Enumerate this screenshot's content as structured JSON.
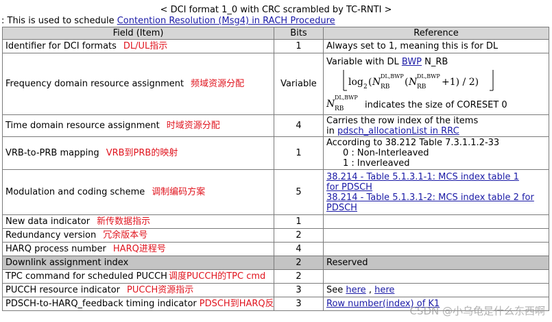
{
  "title": "< DCI format 1_0 with CRC scrambled by TC-RNTI >",
  "intro": {
    "prefix": ": This is used to schedule ",
    "link": "Contention Resolution (Msg4) in RACH Procedure"
  },
  "headers": {
    "field": "Field (Item)",
    "bits": "Bits",
    "reference": "Reference"
  },
  "rows": {
    "r0": {
      "field": "Identifier for DCI formats",
      "cn": "DL/UL指示",
      "bits": "1",
      "ref": "Always set to 1, meaning this is for DL"
    },
    "r1": {
      "field": "Frequency domain resource assignment",
      "cn": "频域资源分配",
      "bits": "Variable",
      "ref_prefix": "Variable with DL ",
      "ref_link": "BWP",
      "ref_suffix": " N_RB",
      "formula_log": "log",
      "formula_sub2": "2",
      "formula_N": "N",
      "formula_sup": "DL,BWP",
      "formula_sub": "RB",
      "formula_plus1": "+1) / 2)",
      "ref_size": "indicates the size of CORESET 0"
    },
    "r2": {
      "field": "Time domain resource assignment",
      "cn": "时域资源分配",
      "bits": "4",
      "ref_line1": "Carries the row index of the items",
      "ref_in": "in ",
      "ref_link": "pdsch_allocationList in RRC"
    },
    "r3": {
      "field": "VRB-to-PRB mapping",
      "cn": "VRB到PRB的映射",
      "bits": "1",
      "ref_line1": "According to 38.212 Table 7.3.1.1.2-33",
      "ref_line2": "0 : Non-Interleaved",
      "ref_line3": "1 : Inverleaved"
    },
    "r4": {
      "field": "Modulation and coding scheme",
      "cn": "调制编码方案",
      "bits": "5",
      "link1a": "38.214  - Table 5.1.3.1-1: MCS index table 1",
      "link1b": "for PDSCH",
      "link2a": "38.214 - Table 5.1.3.1-2: MCS index table 2 for",
      "link2b": "PDSCH"
    },
    "r5": {
      "field": "New data indicator",
      "cn": "新传数据指示",
      "bits": "1",
      "ref": ""
    },
    "r6": {
      "field": "Redundancy version",
      "cn": "冗余版本号",
      "bits": "2",
      "ref": ""
    },
    "r7": {
      "field": "HARQ process number",
      "cn": "HARQ进程号",
      "bits": "4",
      "ref": ""
    },
    "r8": {
      "field": "Downlink assignment index",
      "cn": "",
      "bits": "2",
      "ref": "Reserved"
    },
    "r9": {
      "field": "TPC command for scheduled PUCCH",
      "cn": "调度PUCCH的TPC cmd",
      "bits": "2",
      "ref": ""
    },
    "r10": {
      "field": "PUCCH resource indicator",
      "cn": "PUCCH资源指示",
      "bits": "3",
      "ref_prefix": "See ",
      "link1": "here",
      "sep": " , ",
      "link2": "here"
    },
    "r11": {
      "field": "PDSCH-to-HARQ_feedback timing indicator",
      "cn": "PDSCH到HARQ反馈的时间指",
      "bits": "3",
      "ref_link": "Row number(index) of K1"
    }
  },
  "watermark": "CSDN @小乌龟是什么东西啊"
}
